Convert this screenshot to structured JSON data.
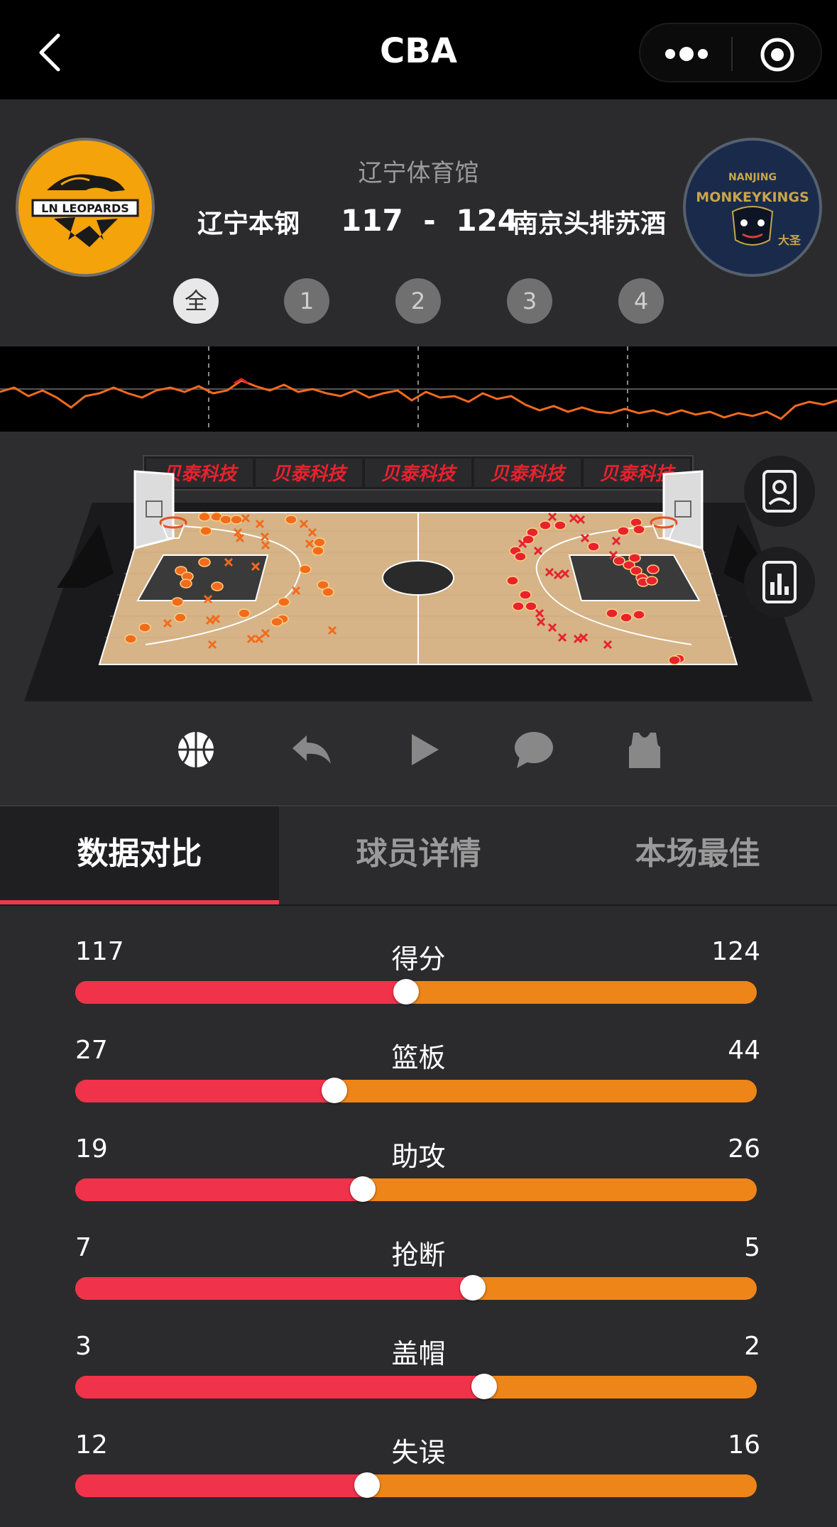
{
  "header": {
    "title": "CBA"
  },
  "game": {
    "venue": "辽宁体育馆",
    "home_team": "辽宁本钢",
    "away_team": "南京头排苏酒",
    "home_score": "117",
    "separator": "-",
    "away_score": "124",
    "home_logo_text": "LN LEOPARDS",
    "away_logo_text": "NANJING MONKEYKINGS"
  },
  "quarters": [
    {
      "label": "全",
      "active": true
    },
    {
      "label": "1",
      "active": false
    },
    {
      "label": "2",
      "active": false
    },
    {
      "label": "3",
      "active": false
    },
    {
      "label": "4",
      "active": false
    }
  ],
  "court": {
    "sponsor": "贝泰科技",
    "home_mark_color": "#f26b1d",
    "away_mark_color": "#e8222e"
  },
  "controls": [
    "basketball-icon",
    "replay-icon",
    "play-icon",
    "comment-icon",
    "jersey-icon"
  ],
  "tabs": [
    {
      "label": "数据对比",
      "active": true
    },
    {
      "label": "球员详情",
      "active": false
    },
    {
      "label": "本场最佳",
      "active": false
    }
  ],
  "stats": [
    {
      "label": "得分",
      "home": "117",
      "away": "124",
      "home_share": 0.4855
    },
    {
      "label": "篮板",
      "home": "27",
      "away": "44",
      "home_share": 0.3803
    },
    {
      "label": "助攻",
      "home": "19",
      "away": "26",
      "home_share": 0.4222
    },
    {
      "label": "抢断",
      "home": "7",
      "away": "5",
      "home_share": 0.5833
    },
    {
      "label": "盖帽",
      "home": "3",
      "away": "2",
      "home_share": 0.6
    },
    {
      "label": "失误",
      "home": "12",
      "away": "16",
      "home_share": 0.4286
    }
  ],
  "colors": {
    "home_bar": "#f1324b",
    "away_bar": "#ee8518",
    "tab_indicator": "#f0384c"
  }
}
